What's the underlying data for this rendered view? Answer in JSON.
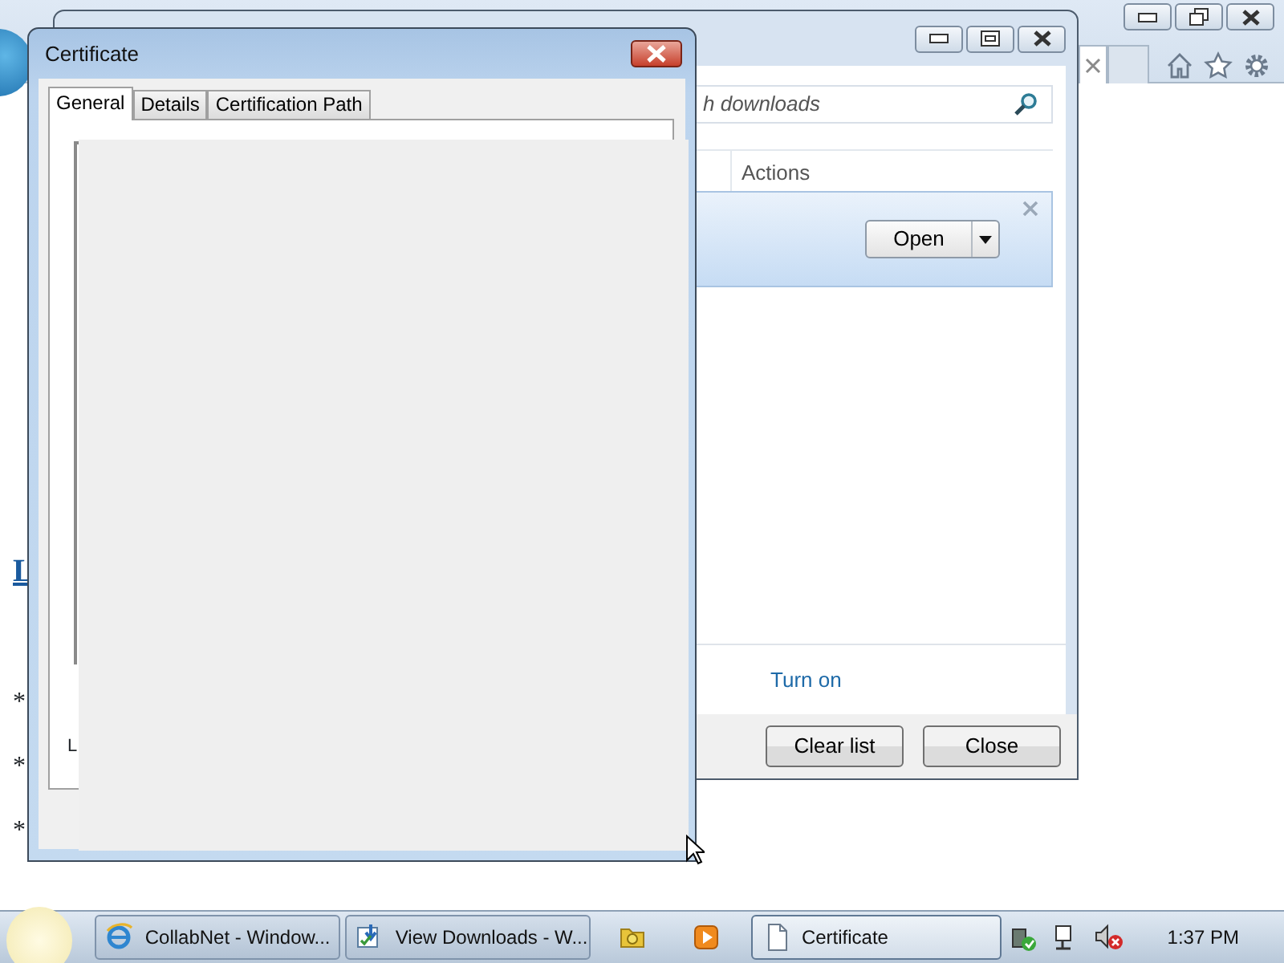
{
  "browser": {
    "page_fragments": [
      {
        "kind": "link",
        "text": "L"
      },
      {
        "kind": "bullet",
        "text": "*"
      },
      {
        "kind": "bullet",
        "text": "*"
      },
      {
        "kind": "bullet",
        "text": "*"
      }
    ]
  },
  "downloads": {
    "search": {
      "placeholder": "h downloads"
    },
    "columns": [
      "Actions"
    ],
    "item": {
      "button": "Open"
    },
    "notification_link": "Turn on",
    "buttons": [
      "Clear list",
      "Close"
    ]
  },
  "certificate": {
    "title": "Certificate",
    "tabs": [
      {
        "label": "General",
        "selected": true
      },
      {
        "label": "Details",
        "selected": false
      },
      {
        "label": "Certification Path",
        "selected": false
      }
    ],
    "content_fragment": "L"
  },
  "taskbar": {
    "items": [
      {
        "kind": "window",
        "label": "CollabNet - Window...",
        "active": false
      },
      {
        "kind": "window",
        "label": "View Downloads - W...",
        "active": false
      },
      {
        "kind": "pinned"
      },
      {
        "kind": "pinned"
      },
      {
        "kind": "window",
        "label": "Certificate",
        "active": true
      }
    ],
    "time": "1:37 PM"
  }
}
